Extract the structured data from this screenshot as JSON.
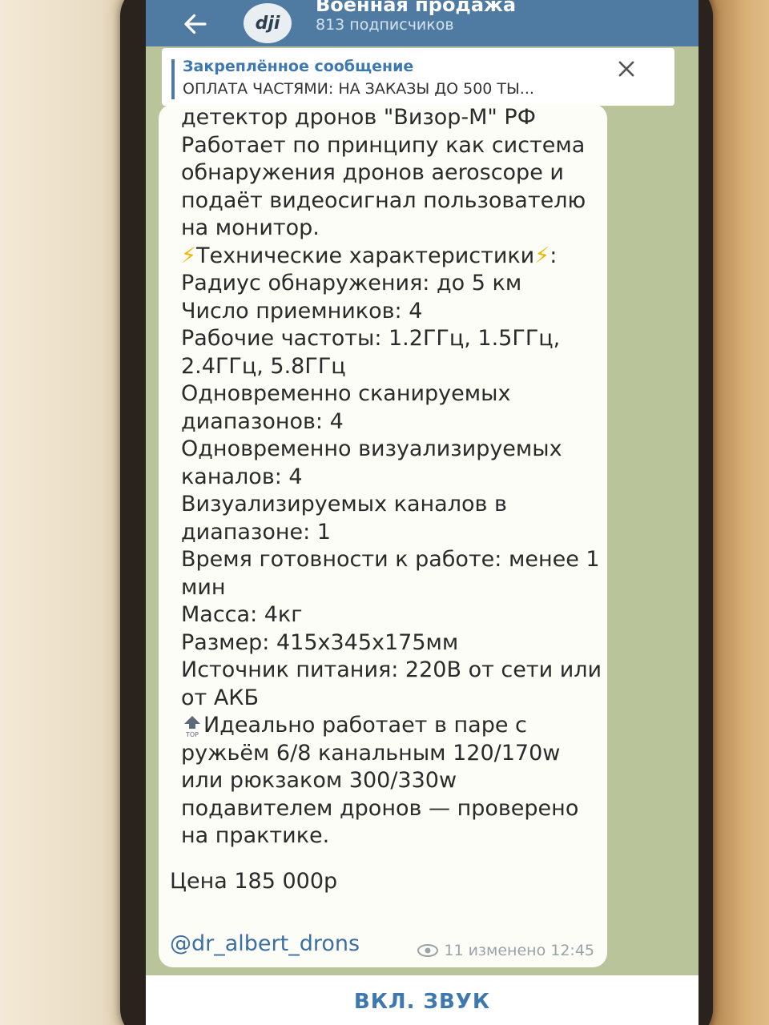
{
  "header": {
    "title": "Военная продажа",
    "subscribers": "813 подписчиков",
    "avatar_text": "dji"
  },
  "pinned": {
    "title": "Закреплённое сообщение",
    "text": "ОПЛАТА ЧАСТЯМИ: НА ЗАКАЗЫ ДО 500 ТЫ..."
  },
  "message": {
    "lines": [
      "детектор дронов \"Визор-М\" РФ",
      "Работает по принципу как система",
      "обнаружения дронов aeroscope и",
      "подаёт видеосигнал пользователю",
      "на монитор.",
      "⚡Технические характеристики⚡:",
      "Радиус обнаружения: до 5 км",
      "Число приемников: 4",
      "Рабочие частоты: 1.2ГГц, 1.5ГГц,",
      "2.4ГГц, 5.8ГГц",
      "Одновременно сканируемых",
      "диапазонов: 4",
      "Одновременно визуализируемых",
      "каналов: 4",
      "Визуализируемых каналов в",
      "диапазоне: 1",
      "Время готовности к работе: менее 1",
      "мин",
      "Масса: 4кг",
      "Размер: 415x345x175мм",
      "Источник питания: 220В от сети или",
      "от АКБ",
      "Идеально работает в паре с",
      "ружьём 6/8 канальным 120/170w",
      "или рюкзаком 300/330w",
      "подавителем дронов — проверено",
      "на практике."
    ],
    "top_icon_label": "TOP",
    "price": "Цена 185 000р",
    "username": "@dr_albert_drons",
    "views": "11",
    "edited_time": "изменено 12:45"
  },
  "bottom": {
    "unmute_label": "ВКЛ. ЗВУК"
  },
  "colors": {
    "header": "#4f7ba3",
    "link": "#3b6ea5",
    "bubble": "#fdfdf7",
    "chat_background": "#b9c49a"
  }
}
